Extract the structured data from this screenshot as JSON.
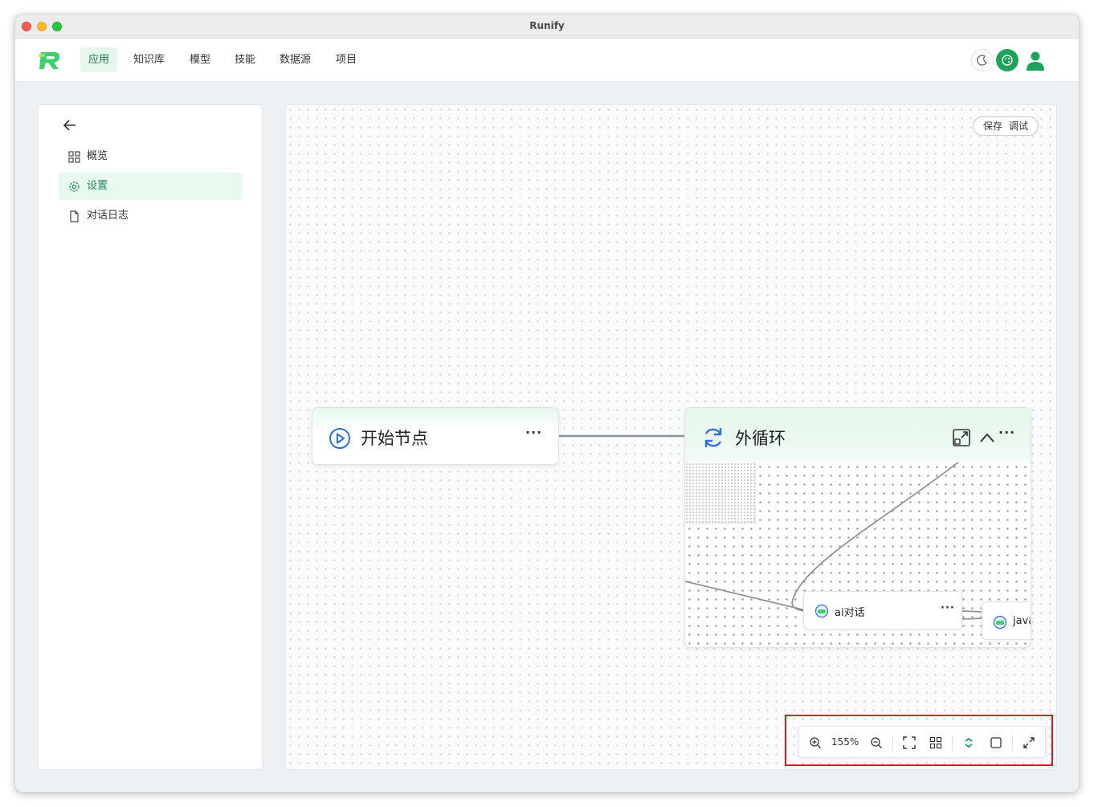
{
  "window": {
    "title": "Runify"
  },
  "topnav": {
    "items": [
      {
        "label": "应用",
        "active": true
      },
      {
        "label": "知识库"
      },
      {
        "label": "模型"
      },
      {
        "label": "技能"
      },
      {
        "label": "数据源"
      },
      {
        "label": "项目"
      }
    ],
    "right_icons": [
      "moon-icon",
      "palette-icon",
      "user-icon"
    ]
  },
  "sidebar": {
    "back_icon": "arrow-left-icon",
    "items": [
      {
        "label": "概览",
        "icon": "grid-icon"
      },
      {
        "label": "设置",
        "icon": "gear-icon",
        "active": true
      },
      {
        "label": "对话日志",
        "icon": "file-icon"
      }
    ]
  },
  "canvas": {
    "save_label": "保存",
    "debug_label": "调试",
    "start_node": {
      "title": "开始节点",
      "icon": "play-circle-icon"
    },
    "loop_node": {
      "title": "外循环",
      "icon": "refresh-icon"
    },
    "sub_nodes": [
      {
        "title": "ai对话"
      },
      {
        "title": "java"
      }
    ]
  },
  "toolbar": {
    "zoom": "155%",
    "icons": [
      "zoom-in-icon",
      "zoom-out-icon",
      "fit-view-icon",
      "layout-icon",
      "sync-icon",
      "select-icon",
      "fullscreen-icon"
    ]
  },
  "colors": {
    "accent": "#1fa35a",
    "brand_blue": "#2f6fe0",
    "highlight": "#e0141e"
  }
}
